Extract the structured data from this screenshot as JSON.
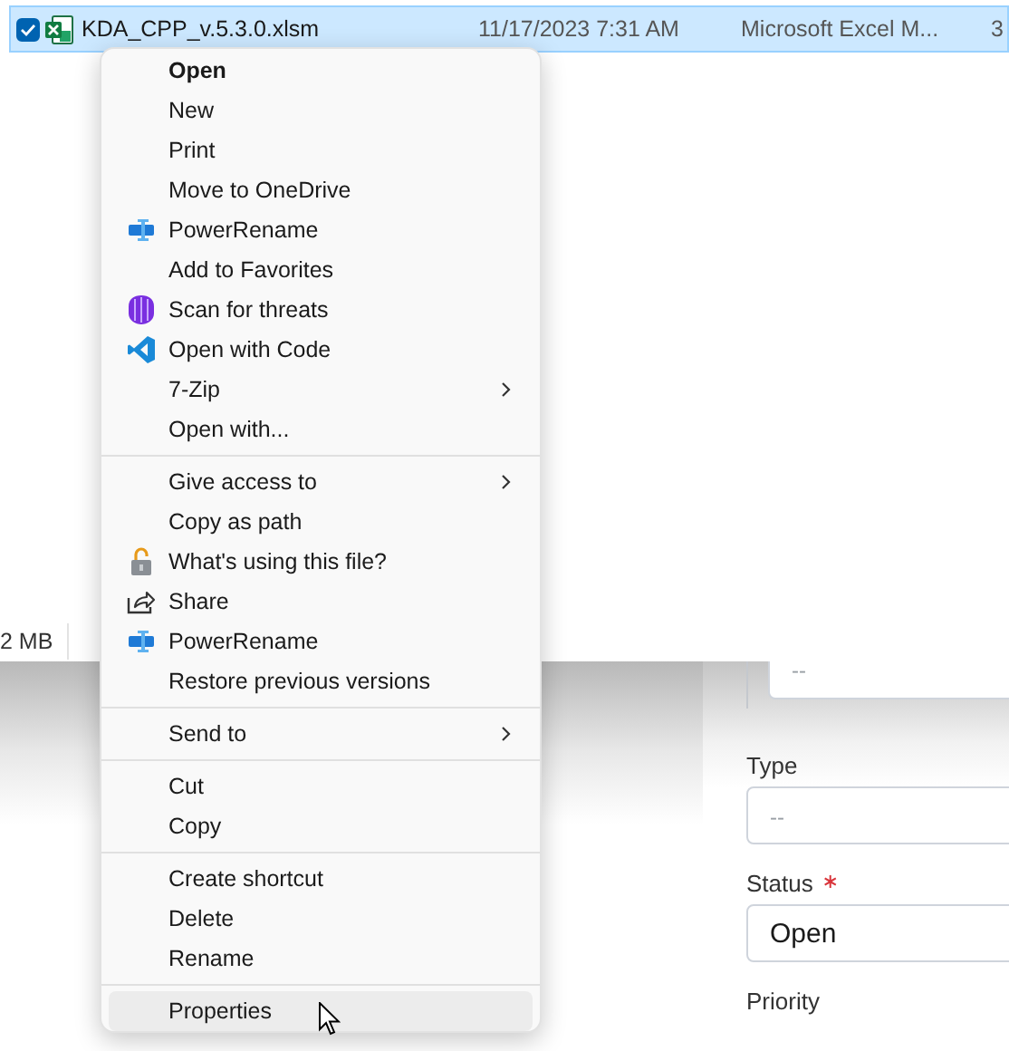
{
  "file_row": {
    "selected": true,
    "checked": true,
    "name": "KDA_CPP_v.5.3.0.xlsm",
    "date_modified": "11/17/2023 7:31 AM",
    "type": "Microsoft Excel M...",
    "column_4": "3"
  },
  "status_bar": {
    "size": "2 MB"
  },
  "context_menu": {
    "groups": [
      [
        {
          "label": "Open",
          "kind": "text",
          "bold": true,
          "hovered": false
        },
        {
          "label": "New",
          "kind": "text",
          "bold": false,
          "hovered": false
        },
        {
          "label": "Print",
          "kind": "text",
          "bold": false,
          "hovered": false
        },
        {
          "label": "Move to OneDrive",
          "kind": "text",
          "bold": false,
          "hovered": false
        },
        {
          "label": "PowerRename",
          "kind": "rename",
          "bold": false,
          "hovered": false
        },
        {
          "label": "Add to Favorites",
          "kind": "text",
          "bold": false,
          "hovered": false
        },
        {
          "label": "Scan for threats",
          "kind": "scan",
          "bold": false,
          "hovered": false
        },
        {
          "label": "Open with Code",
          "kind": "code",
          "bold": false,
          "hovered": false
        },
        {
          "label": "7-Zip",
          "kind": "text",
          "submenu": true,
          "bold": false,
          "hovered": false
        },
        {
          "label": "Open with...",
          "kind": "text",
          "bold": false,
          "hovered": false
        }
      ],
      [
        {
          "label": "Give access to",
          "kind": "text",
          "submenu": true,
          "bold": false,
          "hovered": false
        },
        {
          "label": "Copy as path",
          "kind": "text",
          "bold": false,
          "hovered": false
        },
        {
          "label": "What's using this file?",
          "kind": "lock",
          "bold": false,
          "hovered": false
        },
        {
          "label": "Share",
          "kind": "share",
          "bold": false,
          "hovered": false
        },
        {
          "label": "PowerRename",
          "kind": "rename",
          "bold": false,
          "hovered": false
        },
        {
          "label": "Restore previous versions",
          "kind": "text",
          "bold": false,
          "hovered": false
        }
      ],
      [
        {
          "label": "Send to",
          "kind": "text",
          "submenu": true,
          "bold": false,
          "hovered": false
        }
      ],
      [
        {
          "label": "Cut",
          "kind": "text",
          "bold": false,
          "hovered": false
        },
        {
          "label": "Copy",
          "kind": "text",
          "bold": false,
          "hovered": false
        }
      ],
      [
        {
          "label": "Create shortcut",
          "kind": "text",
          "bold": false,
          "hovered": false
        },
        {
          "label": "Delete",
          "kind": "text",
          "bold": false,
          "hovered": false
        },
        {
          "label": "Rename",
          "kind": "text",
          "bold": false,
          "hovered": false
        }
      ],
      [
        {
          "label": "Properties",
          "kind": "text",
          "bold": false,
          "hovered": true
        }
      ]
    ]
  },
  "form": {
    "fields": [
      {
        "placeholder": "--"
      },
      {
        "label": "Type",
        "required": false,
        "placeholder": "--"
      },
      {
        "label": "Status",
        "required": true,
        "value": "Open"
      },
      {
        "label": "Priority",
        "required": false
      }
    ]
  }
}
